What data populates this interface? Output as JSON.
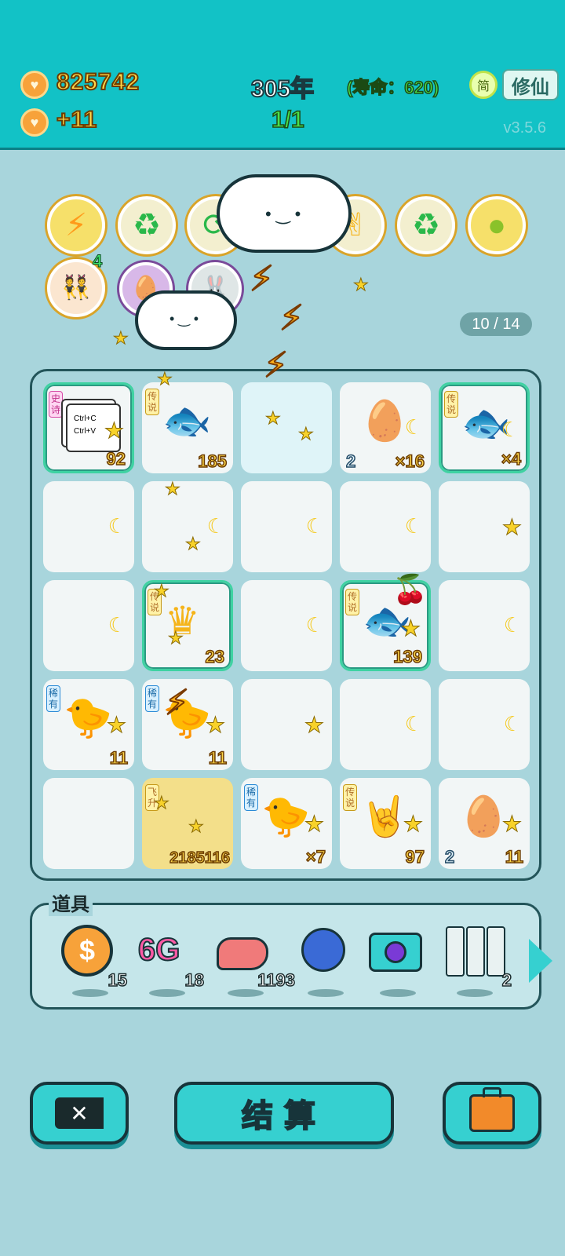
{
  "header": {
    "coins": "825742",
    "coin_rate": "+11",
    "year": "305年",
    "lifespan": "(寿命：620)",
    "stage": "1/1",
    "simplified_label": "简",
    "cultivate_label": "修仙",
    "version": "v3.5.6"
  },
  "buffs": {
    "badge_count": "4",
    "progress": "10 / 14"
  },
  "board": {
    "cells": [
      {
        "tag": "史诗",
        "item": "Ctrl+C",
        "item2": "Ctrl+V",
        "num": "92"
      },
      {
        "tag": "传说",
        "num": "185"
      },
      {
        "tag": "",
        "num": ""
      },
      {
        "tag": "",
        "num_left": "2",
        "num": "×16"
      },
      {
        "tag": "传说",
        "num": "×4"
      },
      {
        "tag": "传说",
        "num": "23"
      },
      {
        "tag": "传说",
        "num": "139"
      },
      {
        "tag": "稀有",
        "num": "11"
      },
      {
        "tag": "稀有",
        "num": "11"
      },
      {
        "tag": "飞升",
        "num": "2185116"
      },
      {
        "tag": "稀有",
        "num": "×7"
      },
      {
        "tag": "传说",
        "num": "97"
      },
      {
        "tag": "",
        "num_left": "2",
        "num": "11"
      }
    ]
  },
  "tools": {
    "title": "道具",
    "items": [
      {
        "icon": "dollar-coin-icon",
        "count": "15"
      },
      {
        "icon": "6g-icon",
        "label": "6G",
        "count": "18"
      },
      {
        "icon": "liver-icon",
        "count": "1193"
      },
      {
        "icon": "blueberry-icon",
        "count": ""
      },
      {
        "icon": "camera-icon",
        "count": ""
      },
      {
        "icon": "rare-cards-icon",
        "count": "2"
      }
    ]
  },
  "footer": {
    "settle_label": "结算"
  },
  "colors": {
    "topbar": "#12c2c6",
    "background": "#a8d5dc",
    "button": "#36d0d0",
    "gold": "#ffd84a"
  }
}
